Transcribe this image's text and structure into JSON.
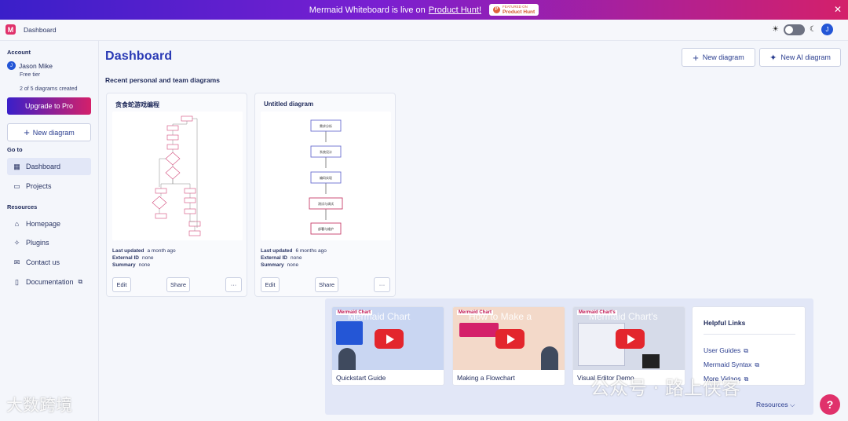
{
  "banner": {
    "text": "Mermaid Whiteboard is live on",
    "link": "Product Hunt!",
    "badge_small": "FEATURED ON",
    "badge_label": "Product Hunt",
    "close": "✕"
  },
  "topbar": {
    "logo": "M",
    "breadcrumb": "Dashboard",
    "sun_icon": "☀",
    "moon_icon": "☾",
    "user_initial": "J"
  },
  "sidebar": {
    "account_heading": "Account",
    "user_initial": "J",
    "user_name": "Jason Mike",
    "tier": "Free tier",
    "usage": "2 of 5 diagrams created",
    "upgrade_label": "Upgrade to Pro",
    "new_diagram_label": "New diagram",
    "goto_heading": "Go to",
    "goto_items": [
      {
        "label": "Dashboard",
        "icon": "dashboard-icon"
      },
      {
        "label": "Projects",
        "icon": "folder-icon"
      }
    ],
    "resources_heading": "Resources",
    "resource_items": [
      {
        "label": "Homepage",
        "icon": "home-icon"
      },
      {
        "label": "Plugins",
        "icon": "plugin-icon"
      },
      {
        "label": "Contact us",
        "icon": "mail-icon"
      },
      {
        "label": "Documentation",
        "icon": "book-icon"
      }
    ]
  },
  "main": {
    "title": "Dashboard",
    "new_diagram": "New diagram",
    "new_ai_diagram": "New AI diagram",
    "section_heading": "Recent personal and team diagrams"
  },
  "cards": [
    {
      "title": "贪食蛇游戏编程",
      "last_updated_label": "Last updated",
      "last_updated": "a month ago",
      "external_id_label": "External ID",
      "external_id": "none",
      "summary_label": "Summary",
      "summary": "none",
      "edit": "Edit",
      "share": "Share",
      "more": "···"
    },
    {
      "title": "Untitled diagram",
      "last_updated_label": "Last updated",
      "last_updated": "6 months ago",
      "external_id_label": "External ID",
      "external_id": "none",
      "summary_label": "Summary",
      "summary": "none",
      "edit": "Edit",
      "share": "Share",
      "more": "···",
      "nodes": [
        "需求分析",
        "系统设计",
        "编码实现",
        "测试与调试",
        "部署与维护"
      ]
    }
  ],
  "videos": [
    {
      "label": "Quickstart Guide",
      "brand": "Mermaid Chart",
      "overlay": "Mermaid Chart",
      "color": "#c9d6f2"
    },
    {
      "label": "Making a Flowchart",
      "brand": "Mermaid Chart",
      "overlay": "How to Make a",
      "color": "#f3d9c9"
    },
    {
      "label": "Visual Editor Demo",
      "brand": "Mermaid Chart's",
      "overlay": "Mermaid Chart's",
      "color": "#d6dbe9"
    }
  ],
  "helpful_links": {
    "title": "Helpful Links",
    "items": [
      "User Guides",
      "Mermaid Syntax",
      "More Videos"
    ],
    "ext_icon": "⧉"
  },
  "resources_link": "Resources ⌵",
  "help_button": "?",
  "watermark": {
    "right": "公众号 · 路上侠客",
    "left": "大数跨境"
  }
}
